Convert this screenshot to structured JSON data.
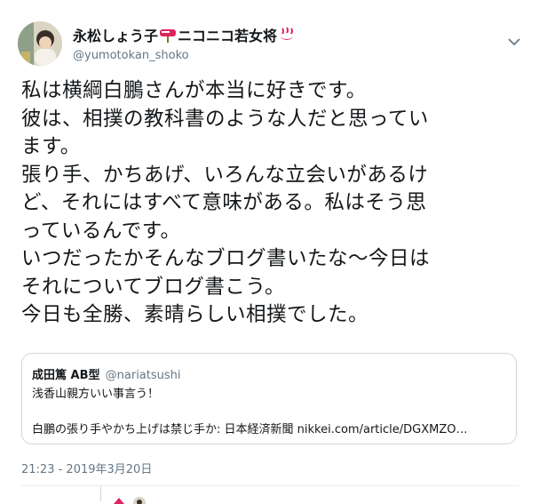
{
  "user": {
    "display_name": "永松しょう子",
    "display_name_suffix": "ニコニコ若女将",
    "handle": "@yumotokan_shoko",
    "avatar_icon": "avatar-photo",
    "name_emoji_1": "postbox-icon",
    "name_emoji_2": "hot-springs-icon",
    "menu_icon": "chevron-down-icon"
  },
  "tweet": {
    "lines": [
      "私は横綱白鵬さんが本当に好きです。",
      "彼は、相撲の教科書のような人だと思ってい",
      "ます。",
      "張り手、かちあげ、いろんな立会いがあるけ",
      "ど、それにはすべて意味がある。私はそう思",
      "っているんです。",
      "いつだったかそんなブログ書いたな〜今日は",
      "それについてブログ書こう。",
      "今日も全勝、素晴らしい相撲でした。"
    ],
    "timestamp": "21:23 - 2019年3月20日"
  },
  "quote": {
    "name": "成田篤 AB型",
    "handle": "@nariatsushi",
    "line1": "浅香山親方いい事言う！",
    "line2": "白鵬の張り手やかち上げは禁じ手か: 日本経済新聞 nikkei.com/article/DGXMZO…"
  },
  "colors": {
    "text": "#14171a",
    "secondary": "#657786",
    "border": "#ccd6dd",
    "emoji_red": "#e0245e"
  }
}
